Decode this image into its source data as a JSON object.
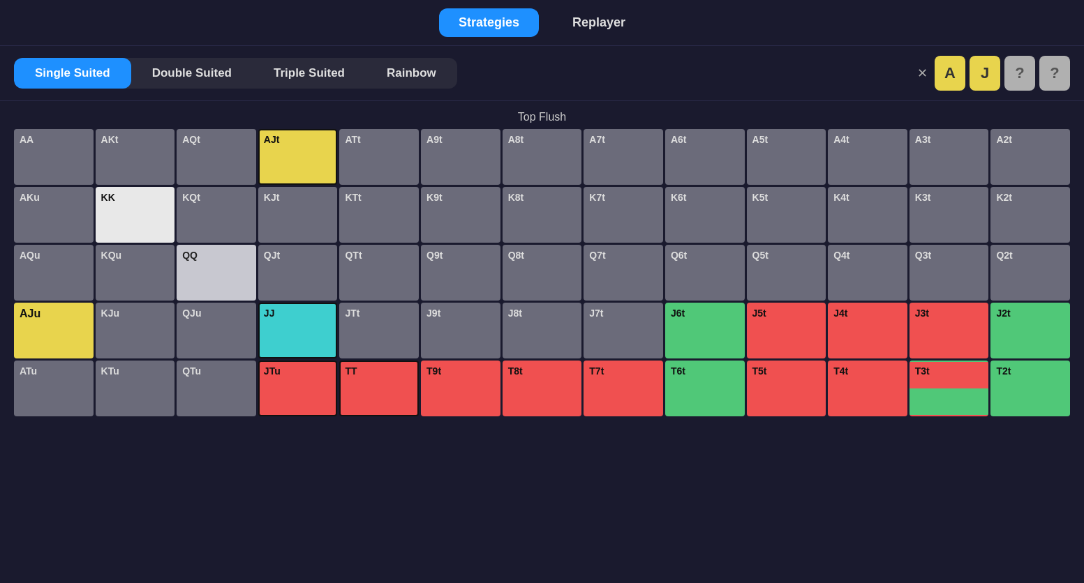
{
  "nav": {
    "strategies_label": "Strategies",
    "replayer_label": "Replayer",
    "active": "strategies"
  },
  "suit_tabs": {
    "tabs": [
      {
        "id": "single",
        "label": "Single Suited",
        "active": true
      },
      {
        "id": "double",
        "label": "Double Suited",
        "active": false
      },
      {
        "id": "triple",
        "label": "Triple Suited",
        "active": false
      },
      {
        "id": "rainbow",
        "label": "Rainbow",
        "active": false
      }
    ]
  },
  "card_badges": [
    {
      "label": "A",
      "style": "yellow"
    },
    {
      "label": "J",
      "style": "yellow"
    },
    {
      "label": "?",
      "style": "gray"
    },
    {
      "label": "?",
      "style": "gray"
    }
  ],
  "section_label": "Top Flush",
  "grid": {
    "rows": [
      [
        {
          "label": "AA",
          "style": "gray-dark",
          "border": false
        },
        {
          "label": "AKt",
          "style": "gray-dark",
          "border": false
        },
        {
          "label": "AQt",
          "style": "gray-dark",
          "border": false
        },
        {
          "label": "AJt",
          "style": "yellow-bg",
          "border": true
        },
        {
          "label": "ATt",
          "style": "gray-dark",
          "border": false
        },
        {
          "label": "A9t",
          "style": "gray-dark",
          "border": false
        },
        {
          "label": "A8t",
          "style": "gray-dark",
          "border": false
        },
        {
          "label": "A7t",
          "style": "gray-dark",
          "border": false
        },
        {
          "label": "A6t",
          "style": "gray-dark",
          "border": false
        },
        {
          "label": "A5t",
          "style": "gray-dark",
          "border": false
        },
        {
          "label": "A4t",
          "style": "gray-dark",
          "border": false
        },
        {
          "label": "A3t",
          "style": "gray-dark",
          "border": false
        },
        {
          "label": "A2t",
          "style": "gray-dark",
          "border": false
        }
      ],
      [
        {
          "label": "AKu",
          "style": "gray-dark",
          "border": false
        },
        {
          "label": "KK",
          "style": "white-bg",
          "border": false
        },
        {
          "label": "KQt",
          "style": "gray-dark",
          "border": false
        },
        {
          "label": "KJt",
          "style": "gray-dark",
          "border": false
        },
        {
          "label": "KTt",
          "style": "gray-dark",
          "border": false
        },
        {
          "label": "K9t",
          "style": "gray-dark",
          "border": false
        },
        {
          "label": "K8t",
          "style": "gray-dark",
          "border": false
        },
        {
          "label": "K7t",
          "style": "gray-dark",
          "border": false
        },
        {
          "label": "K6t",
          "style": "gray-dark",
          "border": false
        },
        {
          "label": "K5t",
          "style": "gray-dark",
          "border": false
        },
        {
          "label": "K4t",
          "style": "gray-dark",
          "border": false
        },
        {
          "label": "K3t",
          "style": "gray-dark",
          "border": false
        },
        {
          "label": "K2t",
          "style": "gray-dark",
          "border": false
        }
      ],
      [
        {
          "label": "AQu",
          "style": "gray-dark",
          "border": false
        },
        {
          "label": "KQu",
          "style": "gray-dark",
          "border": false
        },
        {
          "label": "QQ",
          "style": "gray-light",
          "border": false
        },
        {
          "label": "QJt",
          "style": "gray-dark",
          "border": false
        },
        {
          "label": "QTt",
          "style": "gray-dark",
          "border": false
        },
        {
          "label": "Q9t",
          "style": "gray-dark",
          "border": false
        },
        {
          "label": "Q8t",
          "style": "gray-dark",
          "border": false
        },
        {
          "label": "Q7t",
          "style": "gray-dark",
          "border": false
        },
        {
          "label": "Q6t",
          "style": "gray-dark",
          "border": false
        },
        {
          "label": "Q5t",
          "style": "gray-dark",
          "border": false
        },
        {
          "label": "Q4t",
          "style": "gray-dark",
          "border": false
        },
        {
          "label": "Q3t",
          "style": "gray-dark",
          "border": false
        },
        {
          "label": "Q2t",
          "style": "gray-dark",
          "border": false
        }
      ],
      [
        {
          "label": "AJu",
          "style": "yellow-bg",
          "border": false,
          "bold": true
        },
        {
          "label": "KJu",
          "style": "gray-dark",
          "border": false
        },
        {
          "label": "QJu",
          "style": "gray-dark",
          "border": false
        },
        {
          "label": "JJ",
          "style": "cyan-bg",
          "border": true
        },
        {
          "label": "JTt",
          "style": "gray-dark",
          "border": false
        },
        {
          "label": "J9t",
          "style": "gray-dark",
          "border": false
        },
        {
          "label": "J8t",
          "style": "gray-dark",
          "border": false
        },
        {
          "label": "J7t",
          "style": "gray-dark",
          "border": false
        },
        {
          "label": "J6t",
          "style": "green-bg",
          "border": false
        },
        {
          "label": "J5t",
          "style": "red-bg",
          "border": false
        },
        {
          "label": "J4t",
          "style": "red-bg",
          "border": false
        },
        {
          "label": "J3t",
          "style": "red-bg",
          "border": false
        },
        {
          "label": "J2t",
          "style": "green-bg",
          "border": false
        }
      ],
      [
        {
          "label": "ATu",
          "style": "gray-dark",
          "border": false
        },
        {
          "label": "KTu",
          "style": "gray-dark",
          "border": false
        },
        {
          "label": "QTu",
          "style": "gray-dark",
          "border": false
        },
        {
          "label": "JTu",
          "style": "red-bg",
          "border": true
        },
        {
          "label": "TT",
          "style": "red-bg",
          "border": true
        },
        {
          "label": "T9t",
          "style": "red-bg",
          "border": false
        },
        {
          "label": "T8t",
          "style": "red-bg",
          "border": false
        },
        {
          "label": "T7t",
          "style": "red-bg",
          "border": false
        },
        {
          "label": "T6t",
          "style": "green-bg",
          "border": false
        },
        {
          "label": "T5t",
          "style": "red-bg",
          "border": false
        },
        {
          "label": "T4t",
          "style": "red-bg",
          "border": false
        },
        {
          "label": "T3t",
          "style": "red-green",
          "border": false
        },
        {
          "label": "T2t",
          "style": "green-bg",
          "border": false
        }
      ]
    ]
  }
}
